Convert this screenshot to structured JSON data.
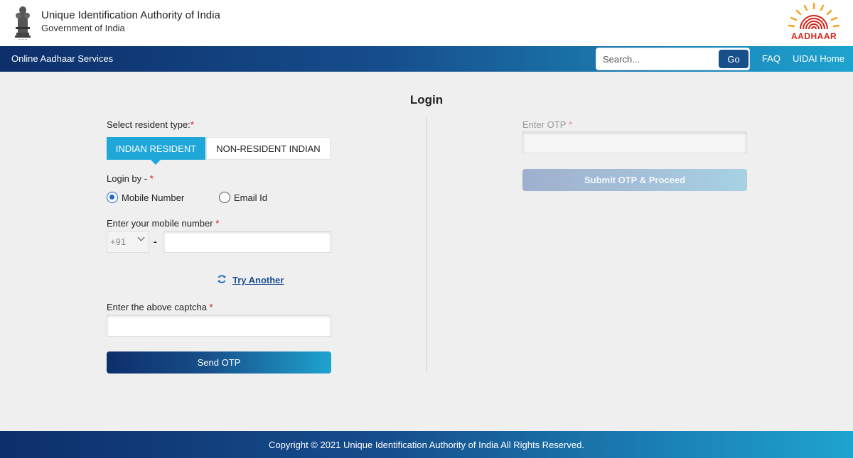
{
  "header": {
    "org_name": "Unique Identification Authority of India",
    "org_sub": "Government of India",
    "emblem_icon": "ashoka-emblem-icon",
    "logo_icon": "aadhaar-sun-logo",
    "logo_text": "AADHAAR"
  },
  "navbar": {
    "title": "Online Aadhaar Services",
    "search_placeholder": "Search...",
    "search_button": "Go",
    "links": [
      "FAQ",
      "UIDAI Home"
    ]
  },
  "login": {
    "title": "Login",
    "resident_type_label": "Select resident type:",
    "tabs": [
      "INDIAN RESIDENT",
      "NON-RESIDENT INDIAN"
    ],
    "login_by_label": "Login by - ",
    "login_options": [
      "Mobile Number",
      "Email Id"
    ],
    "selected_option": "Mobile Number",
    "mobile_label": "Enter your mobile number ",
    "country_code": "+91",
    "separator": "-",
    "try_another": "Try Another",
    "captcha_label": "Enter the above captcha ",
    "send_otp": "Send OTP",
    "otp_label": "Enter OTP ",
    "submit_otp": "Submit OTP & Proceed",
    "required_mark": "*"
  },
  "footer": {
    "copyright": "Copyright © 2021 Unique Identification Authority of India All Rights Reserved."
  },
  "colors": {
    "nav_gradient_start": "#0d2f6b",
    "nav_gradient_end": "#1ea3cf",
    "tab_active": "#1ea7d8",
    "link": "#1c4f8f",
    "required": "#dd1111",
    "logo_red": "#d6251b",
    "logo_orange": "#f2a21e"
  }
}
